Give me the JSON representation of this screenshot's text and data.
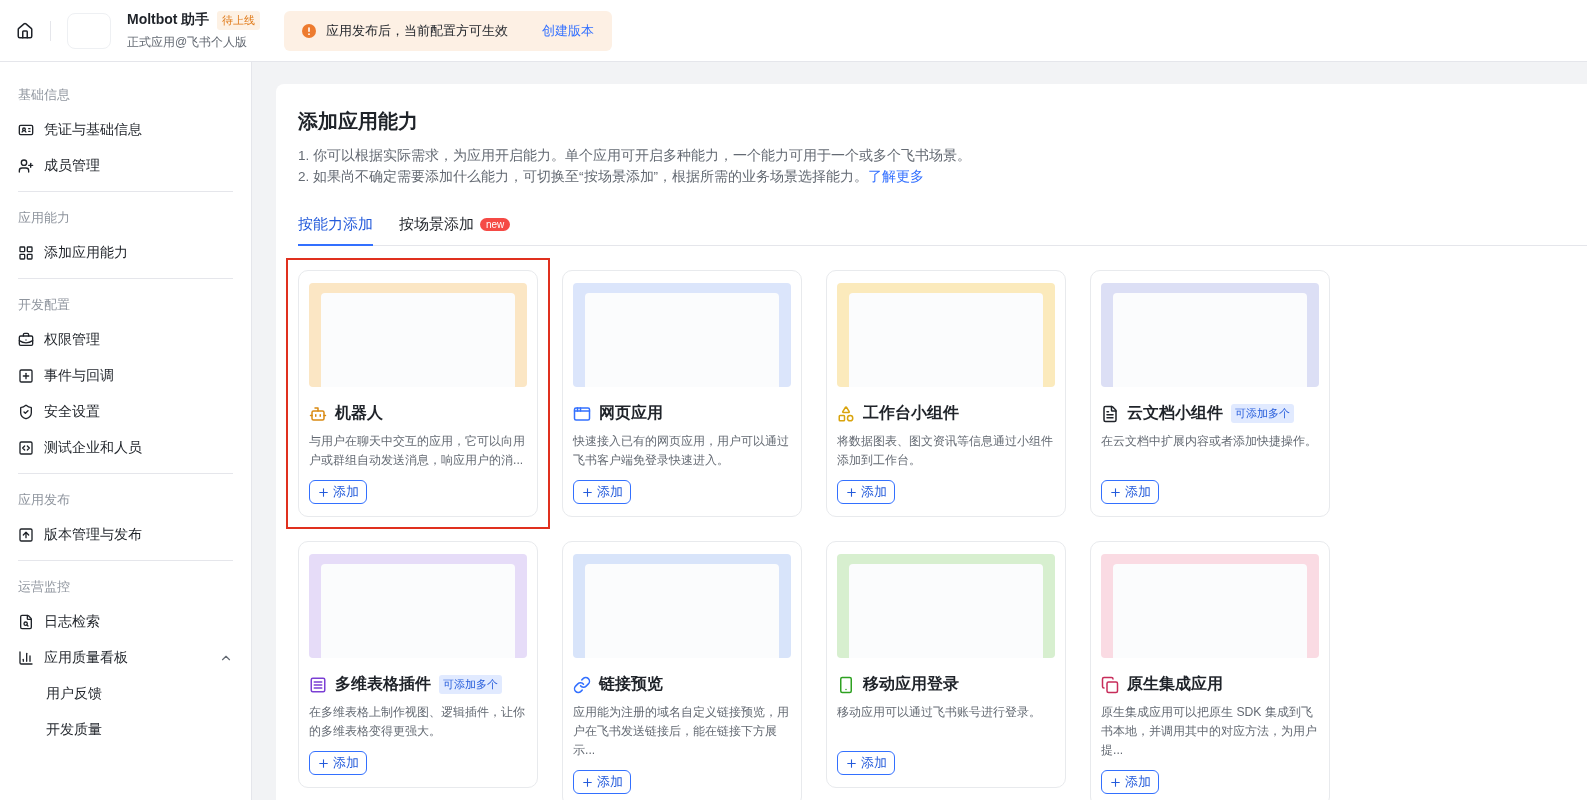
{
  "topbar": {
    "app_name": "Moltbot 助手",
    "status": "待上线",
    "subtitle": "正式应用@飞书个人版",
    "notice": "应用发布后，当前配置方可生效",
    "notice_link": "创建版本"
  },
  "sidebar": {
    "sections": [
      {
        "title": "基础信息",
        "items": [
          {
            "label": "凭证与基础信息"
          },
          {
            "label": "成员管理"
          }
        ]
      },
      {
        "title": "应用能力",
        "items": [
          {
            "label": "添加应用能力"
          }
        ]
      },
      {
        "title": "开发配置",
        "items": [
          {
            "label": "权限管理"
          },
          {
            "label": "事件与回调"
          },
          {
            "label": "安全设置"
          },
          {
            "label": "测试企业和人员"
          }
        ]
      },
      {
        "title": "应用发布",
        "items": [
          {
            "label": "版本管理与发布"
          }
        ]
      },
      {
        "title": "运营监控",
        "items": [
          {
            "label": "日志检索"
          },
          {
            "label": "应用质量看板",
            "expanded": true,
            "children": [
              {
                "label": "用户反馈"
              },
              {
                "label": "开发质量"
              }
            ]
          }
        ]
      }
    ]
  },
  "page": {
    "title": "添加应用能力",
    "intro": [
      {
        "text": "1. 你可以根据实际需求，为应用开启能力。单个应用可开启多种能力，一个能力可用于一个或多个飞书场景。"
      },
      {
        "text": "2. 如果尚不确定需要添加什么能力，可切换至“按场景添加”，根据所需的业务场景选择能力。",
        "link": "了解更多"
      }
    ],
    "tabs": [
      {
        "label": "按能力添加",
        "selected": true
      },
      {
        "label": "按场景添加",
        "selected": false,
        "badge": "new"
      }
    ],
    "cards": [
      {
        "title": "机器人",
        "description": "与用户在聊天中交互的应用，它可以向用户或群组自动发送消息，响应用户的消...",
        "button": "添加",
        "color": "#fbe6c4",
        "highlighted": true
      },
      {
        "title": "网页应用",
        "description": "快速接入已有的网页应用，用户可以通过飞书客户端免登录快速进入。",
        "button": "添加",
        "color": "#dbe5fb",
        "highlighted": false
      },
      {
        "title": "工作台小组件",
        "description": "将数据图表、图文资讯等信息通过小组件添加到工作台。",
        "button": "添加",
        "color": "#fbeabc",
        "highlighted": false
      },
      {
        "title": "云文档小组件",
        "tag": "可添加多个",
        "description": "在云文档中扩展内容或者添加快捷操作。",
        "button": "添加",
        "color": "#dcdff5",
        "highlighted": false
      },
      {
        "title": "多维表格插件",
        "tag": "可添加多个",
        "description": "在多维表格上制作视图、逻辑插件，让你的多维表格变得更强大。",
        "button": "添加",
        "color": "#e6dcf8",
        "highlighted": false
      },
      {
        "title": "链接预览",
        "description": "应用能为注册的域名自定义链接预览，用户在飞书发送链接后，能在链接下方展示...",
        "button": "添加",
        "color": "#d8e4fa",
        "highlighted": false
      },
      {
        "title": "移动应用登录",
        "description": "移动应用可以通过飞书账号进行登录。",
        "button": "添加",
        "color": "#d7efcf",
        "highlighted": false
      },
      {
        "title": "原生集成应用",
        "description": "原生集成应用可以把原生 SDK 集成到飞书本地，并调用其中的对应方法，为用户提...",
        "button": "添加",
        "color": "#fadbe3",
        "highlighted": false
      }
    ]
  }
}
